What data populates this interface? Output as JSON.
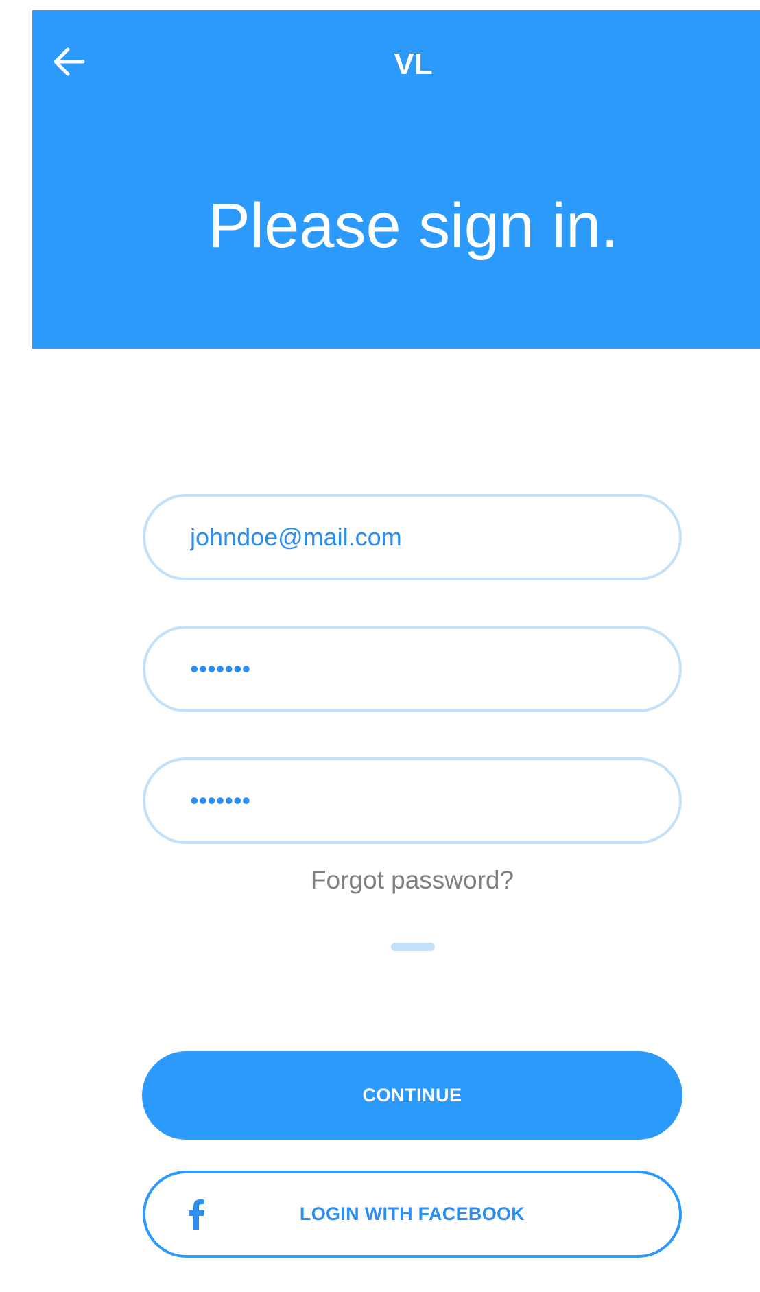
{
  "header": {
    "logo": "VL",
    "title": "Please sign in."
  },
  "form": {
    "email_value": "johndoe@mail.com",
    "password_value": "•••••••",
    "confirm_password_value": "•••••••",
    "forgot_password_label": "Forgot password?"
  },
  "actions": {
    "continue_label": "CONTINUE",
    "facebook_label": "LOGIN WITH FACEBOOK"
  },
  "colors": {
    "primary": "#2b9afb",
    "field_border": "#c3e1fb",
    "muted_text": "#7f7f7f"
  },
  "icons": {
    "back": "arrow-left-icon",
    "facebook": "facebook-icon"
  }
}
